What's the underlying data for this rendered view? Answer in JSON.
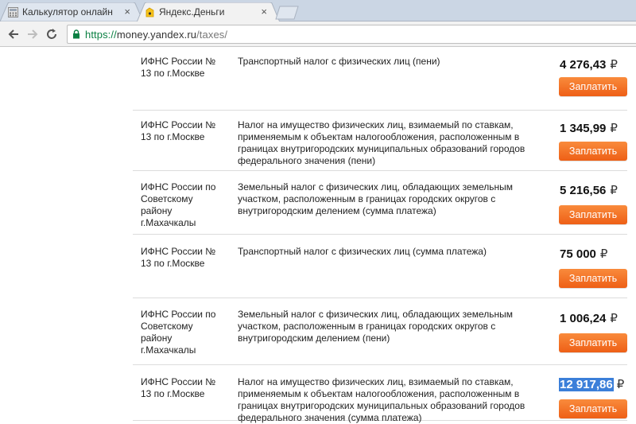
{
  "browser": {
    "tabs": [
      {
        "title": "Калькулятор онлайн",
        "close": "×"
      },
      {
        "title": "Яндекс.Деньги",
        "close": "×"
      }
    ],
    "url": {
      "scheme": "https://",
      "host": "money.yandex.ru",
      "path": "/taxes/"
    }
  },
  "taxes": {
    "pay_label": "Заплатить",
    "currency": "₽",
    "rows": [
      {
        "org": "ИФНС России № 13 по г.Москве",
        "desc": "Транспортный налог с физических лиц (пени)",
        "amount": "4 276,43"
      },
      {
        "org": "ИФНС России № 13 по г.Москве",
        "desc": "Налог на имущество физических лиц, взимаемый по ставкам, применяемым к объектам налогообложения, расположенным в границах внутригородских муниципальных образований городов федерального значения (пени)",
        "amount": "1 345,99"
      },
      {
        "org": "ИФНС России по Советскому району г.Махачкалы",
        "desc": "Земельный налог с физических лиц, обладающих земельным участком, расположенным в границах городских округов с внутригородским делением (сумма платежа)",
        "amount": "5 216,56"
      },
      {
        "org": "ИФНС России № 13 по г.Москве",
        "desc": "Транспортный налог с физических лиц (сумма платежа)",
        "amount": "75 000"
      },
      {
        "org": "ИФНС России по Советскому району г.Махачкалы",
        "desc": "Земельный налог с физических лиц, обладающих земельным участком, расположенным в границах городских округов с внутригородским делением (пени)",
        "amount": "1 006,24"
      },
      {
        "org": "ИФНС России № 13 по г.Москве",
        "desc": "Налог на имущество физических лиц, взимаемый по ставкам, применяемым к объектам налогообложения, расположенным в границах внутригородских муниципальных образований городов федерального значения (сумма платежа)",
        "amount": "12 917,86",
        "selected": true
      }
    ]
  },
  "colors": {
    "pay_button": "#f26b21",
    "selection": "#3b7fd9",
    "secure_scheme": "#0b8043"
  }
}
